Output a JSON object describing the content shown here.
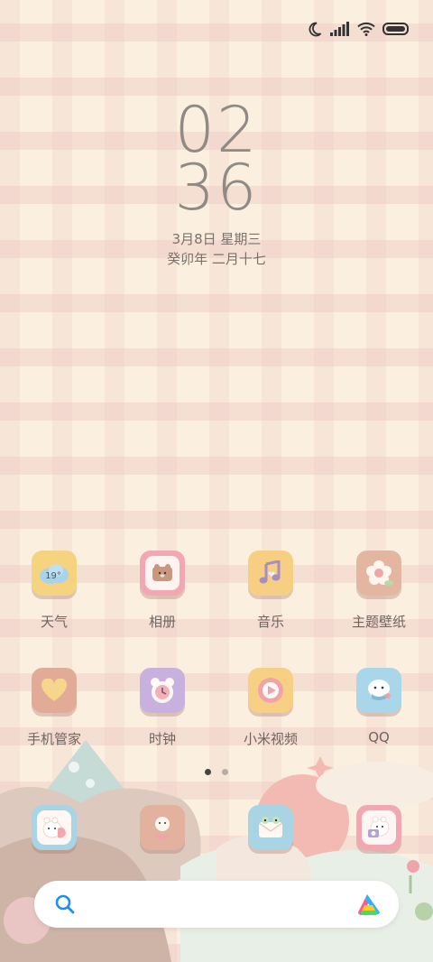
{
  "status_bar": {
    "icons": [
      "moon-icon",
      "signal-icon",
      "wifi-icon",
      "battery-icon"
    ]
  },
  "clock": {
    "hour": "02",
    "minute": "36",
    "date": "3月8日 星期三",
    "lunar": "癸卯年 二月十七"
  },
  "apps_row1": [
    {
      "label": "天气",
      "icon": "weather-icon",
      "temp": "19°"
    },
    {
      "label": "相册",
      "icon": "gallery-icon"
    },
    {
      "label": "音乐",
      "icon": "music-icon"
    },
    {
      "label": "主题壁纸",
      "icon": "themes-icon"
    }
  ],
  "apps_row2": [
    {
      "label": "手机管家",
      "icon": "security-icon"
    },
    {
      "label": "时钟",
      "icon": "clock-icon"
    },
    {
      "label": "小米视频",
      "icon": "video-icon"
    },
    {
      "label": "QQ",
      "icon": "qq-icon"
    }
  ],
  "page_indicator": {
    "pages": 2,
    "current": 1
  },
  "dock": [
    {
      "icon": "phone-icon"
    },
    {
      "icon": "messages-icon"
    },
    {
      "icon": "mail-icon"
    },
    {
      "icon": "camera-icon"
    }
  ],
  "search_bar": {
    "icons": [
      "search-icon",
      "assistant-icon"
    ]
  }
}
